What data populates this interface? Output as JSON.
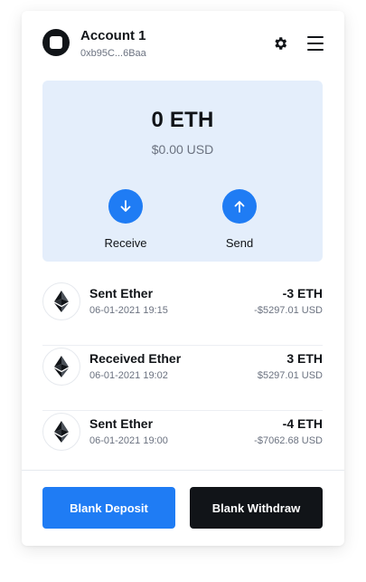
{
  "header": {
    "account_name": "Account 1",
    "account_address": "0xb95C...6Baa"
  },
  "balance": {
    "eth": "0 ETH",
    "usd": "$0.00 USD",
    "receive_label": "Receive",
    "send_label": "Send"
  },
  "transactions": [
    {
      "title": "Sent Ether",
      "date": "06-01-2021 19:15",
      "amount": "-3 ETH",
      "usd": "-$5297.01 USD"
    },
    {
      "title": "Received Ether",
      "date": "06-01-2021 19:02",
      "amount": "3 ETH",
      "usd": "$5297.01 USD"
    },
    {
      "title": "Sent Ether",
      "date": "06-01-2021 19:00",
      "amount": "-4 ETH",
      "usd": "-$7062.68 USD"
    }
  ],
  "actions": {
    "deposit_label": "Blank Deposit",
    "withdraw_label": "Blank Withdraw"
  },
  "colors": {
    "accent": "#1f7cf4",
    "panel": "#e4eefb",
    "dark": "#111418"
  },
  "icons": {
    "avatar": "account-avatar-icon",
    "settings": "gear-icon",
    "menu": "hamburger-menu-icon",
    "receive": "arrow-down-icon",
    "send": "arrow-up-icon",
    "tx": "ethereum-icon"
  }
}
